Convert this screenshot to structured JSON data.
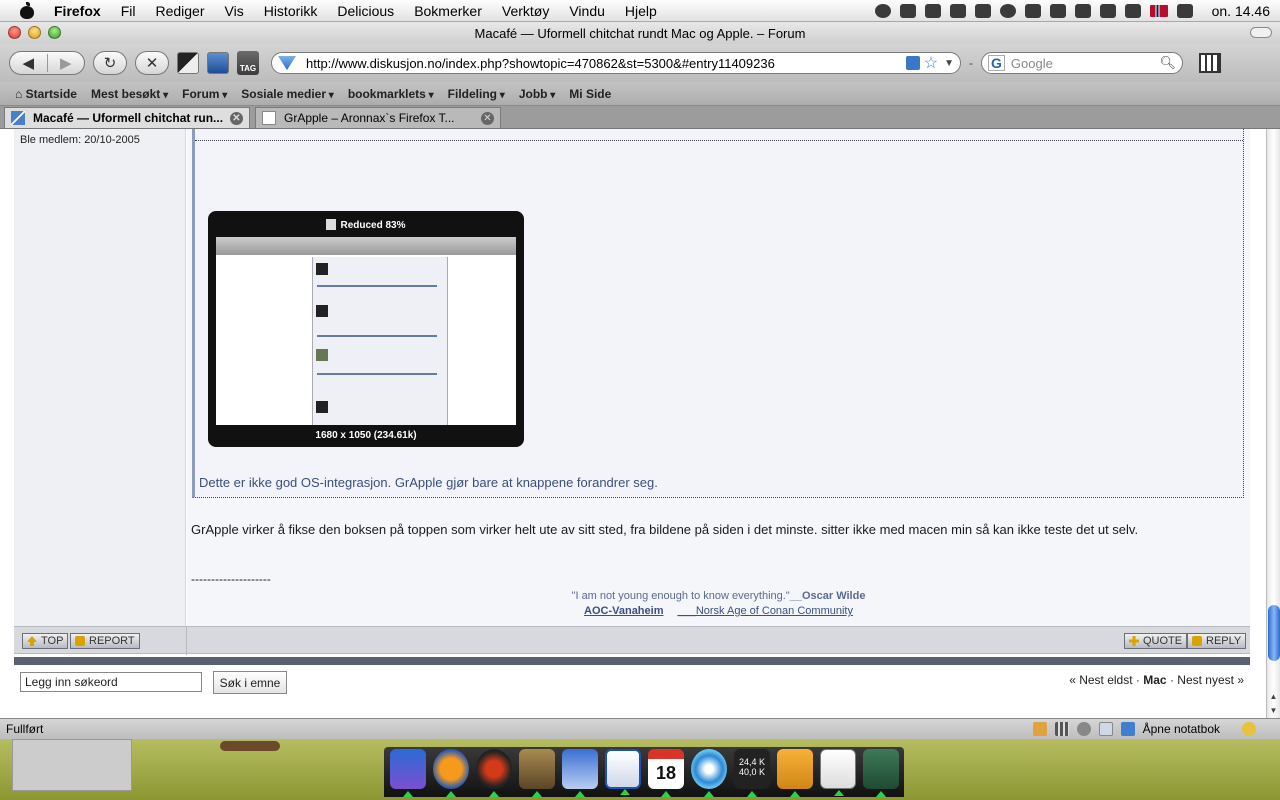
{
  "menubar": {
    "app": "Firefox",
    "items": [
      "Fil",
      "Rediger",
      "Vis",
      "Historikk",
      "Delicious",
      "Bokmerker",
      "Verktøy",
      "Vindu",
      "Hjelp"
    ],
    "clock": "on. 14.46",
    "status_icons": [
      "growl-icon",
      "butterfly-icon",
      "itunes-note-icon",
      "bluetooth-dropdown-icon",
      "twitter-bird-icon",
      "sync-icon",
      "battery-meter-icon",
      "spaces-icon",
      "bluetooth-icon",
      "wifi-icon",
      "volume-icon",
      "norway-flag-icon",
      "battery-icon"
    ]
  },
  "window": {
    "title": "Macafé — Uformell chitchat rundt Mac og Apple. – Forum"
  },
  "navbar": {
    "back_label": "◀",
    "forward_label": "▶",
    "reload_label": "↻",
    "stop_label": "✕",
    "tag_label": "TAG",
    "url": "http://www.diskusjon.no/index.php?showtopic=470862&st=5300&#entry11409236",
    "search_engine": "G",
    "search_placeholder": "Google"
  },
  "bookmarks": [
    {
      "label": "Startside",
      "folder": false
    },
    {
      "label": "Mest besøkt",
      "folder": true
    },
    {
      "label": "Forum",
      "folder": true
    },
    {
      "label": "Sosiale medier",
      "folder": true
    },
    {
      "label": "bookmarklets",
      "folder": true
    },
    {
      "label": "Fildeling",
      "folder": true
    },
    {
      "label": "Jobb",
      "folder": true
    },
    {
      "label": "Mi Side",
      "folder": false
    }
  ],
  "tabs": [
    {
      "label": "Macafé — Uformell chitchat run...",
      "active": true
    },
    {
      "label": "GrApple – Aronnax`s Firefox T...",
      "active": false
    }
  ],
  "post": {
    "member_since": "Ble medlem: 20/10-2005",
    "thumbnail": {
      "top_caption": "Reduced 83%",
      "bottom_caption": "1680 x 1050 (234.61k)"
    },
    "quote_text": "Dette er ikke god OS-integrasjon. GrApple gjør bare at knappene forandrer seg.",
    "body_text": "GrApple virker å fikse den boksen på toppen som virker helt ute av sitt sted, fra bildene på siden i det minste. sitter ikke med macen min så kan ikke teste det ut selv.",
    "signature_rule": "--------------------",
    "signature_quote": "\"I am not young enough to know everything.\"",
    "signature_author": "__Oscar Wilde",
    "signature_link_bold": "AOC-Vanaheim",
    "signature_link_text": "___Norsk Age of Conan Community"
  },
  "post_footer": {
    "top_label": "TOP",
    "report_label": "REPORT",
    "quote_label": "QUOTE",
    "reply_label": "REPLY"
  },
  "topic_search": {
    "input_value": "Legg inn søkeord",
    "button_label": "Søk i emne"
  },
  "topic_nav": {
    "prev": "« Nest eldst",
    "sep1": "·",
    "current": "Mac",
    "sep2": "·",
    "next": "Nest nyest »"
  },
  "statusbar": {
    "status": "Fullført",
    "notebook_label": "Åpne notatbok"
  },
  "dock": {
    "calendar_day": "18",
    "network_up": "24,4 K",
    "network_down": "40,0 K"
  }
}
